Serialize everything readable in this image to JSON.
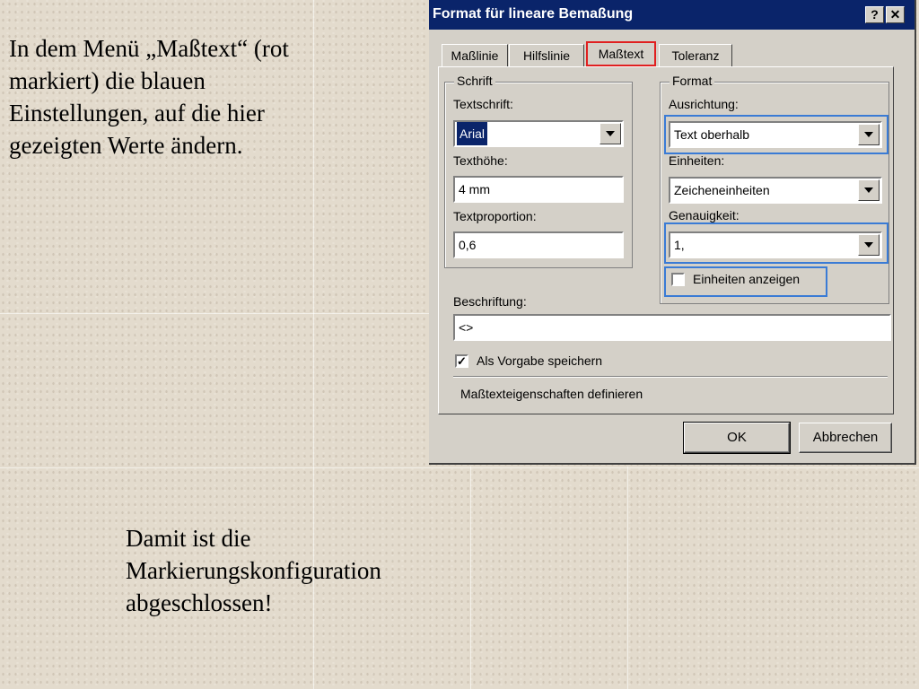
{
  "slide": {
    "instruction": "In dem Menü „Maßtext“ (rot\nmarkiert) die blauen\nEinstellungen, auf die hier\ngezeigten Werte ändern.",
    "conclusion": "Damit ist die\nMarkierungskonfiguration\nabgeschlossen!"
  },
  "dialog": {
    "title": "Format für lineare Bemaßung",
    "help_button": "?",
    "close_button": "✕",
    "tabs": [
      "Maßlinie",
      "Hilfslinie",
      "Maßtext",
      "Toleranz"
    ],
    "active_tab": "Maßtext",
    "schrift": {
      "legend": "Schrift",
      "textschrift_label": "Textschrift:",
      "textschrift_value": "Arial",
      "texthoehe_label": "Texthöhe:",
      "texthoehe_value": "4 mm",
      "textproportion_label": "Textproportion:",
      "textproportion_value": "0,6"
    },
    "format": {
      "legend": "Format",
      "ausrichtung_label": "Ausrichtung:",
      "ausrichtung_value": "Text oberhalb",
      "einheiten_label": "Einheiten:",
      "einheiten_value": "Zeicheneinheiten",
      "genauigkeit_label": "Genauigkeit:",
      "genauigkeit_value": "1,",
      "einheiten_anzeigen_label": "Einheiten anzeigen",
      "einheiten_anzeigen_checked": false
    },
    "beschriftung_label": "Beschriftung:",
    "beschriftung_value": "<>",
    "als_vorgabe_label": "Als Vorgabe speichern",
    "als_vorgabe_checked": true,
    "status_text": "Maßtexteigenschaften definieren",
    "ok_label": "OK",
    "cancel_label": "Abbrechen"
  },
  "colors": {
    "titlebar": "#0a246a",
    "highlight_red": "#e02020",
    "highlight_blue": "#3a7bd5",
    "dialog_face": "#d4d0c8"
  }
}
